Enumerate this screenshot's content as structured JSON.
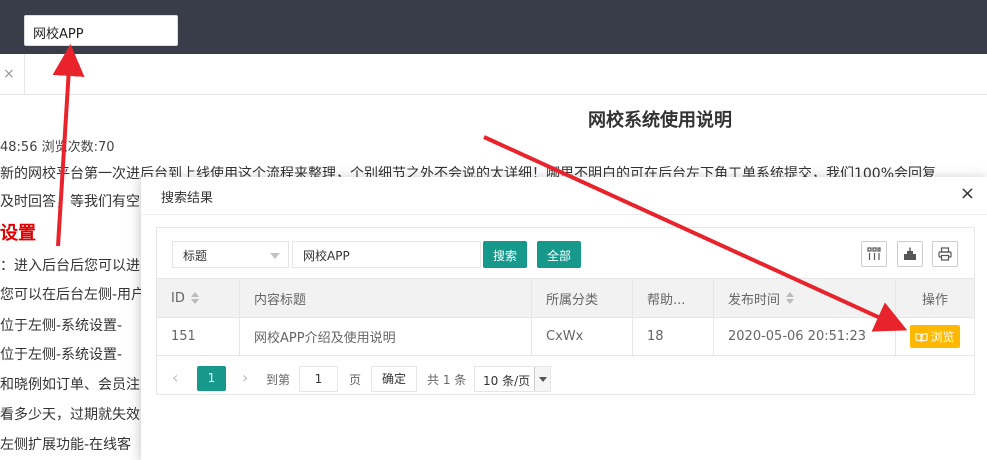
{
  "header": {
    "search_value": "网校APP"
  },
  "tabbar": {
    "close_glyph": "×"
  },
  "article": {
    "title": "网校系统使用说明",
    "meta": "48:56 浏览次数:70",
    "lines": [
      "新的网校平台第一次进后台到上线使用这个流程来整理，个别细节之外不会说的太详细！哪里不明白的可在后台左下角工单系统提交，我们100%会回复",
      "及时回答，等我们有空",
      "：进入后台后您可以进",
      "您可以在后台左侧-用户",
      "位于左侧-系统设置-",
      "位于左侧-系统设置-",
      "和晓例如订单、会员注",
      "看多少天，过期就失效",
      "左侧扩展功能-在线客"
    ],
    "heading": "设置"
  },
  "modal": {
    "title": "搜索结果",
    "close_glyph": "×",
    "toolbar": {
      "field_select": "标题",
      "keyword": "网校APP",
      "search_label": "搜索",
      "all_label": "全部"
    },
    "table": {
      "columns": [
        "ID",
        "内容标题",
        "所属分类",
        "帮助...",
        "发布时间",
        "操作"
      ],
      "rows": [
        {
          "id": "151",
          "title": "网校APP介绍及使用说明",
          "category": "CxWx",
          "help": "18",
          "time": "2020-05-06 20:51:23",
          "action": "浏览"
        }
      ]
    },
    "pager": {
      "prev": "‹",
      "current": "1",
      "next": "›",
      "goto_label": "到第",
      "goto_value": "1",
      "page_label": "页",
      "confirm_label": "确定",
      "total_label": "共 1 条",
      "page_size": "10 条/页"
    }
  },
  "colors": {
    "topbar": "#393d49",
    "primary_green": "#16998b",
    "warning_yellow": "#ffb800",
    "annotation_red": "#e8232b",
    "heading_red": "#e00000"
  }
}
